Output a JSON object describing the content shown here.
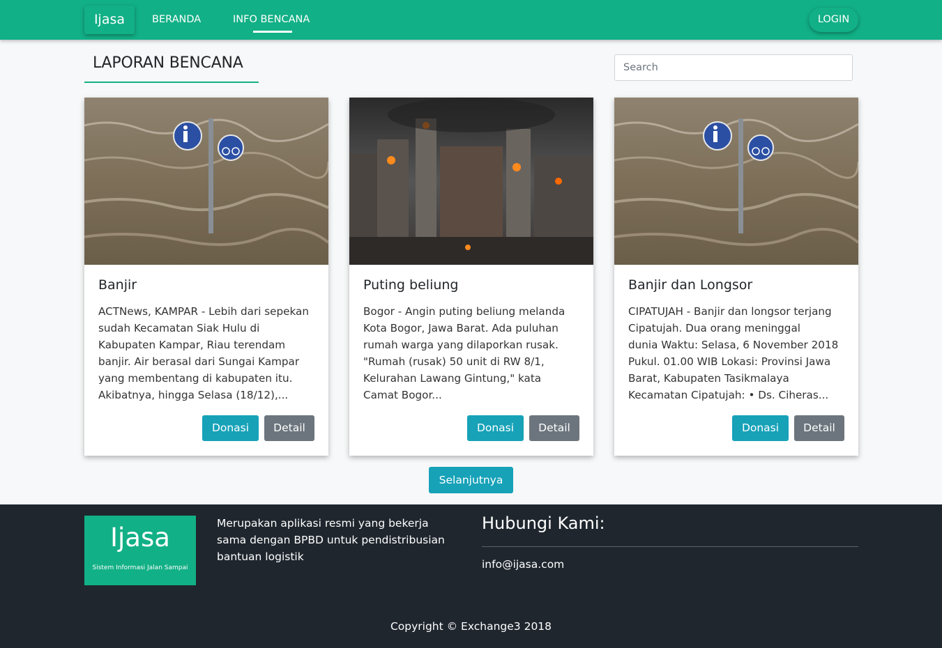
{
  "nav": {
    "brand": "Ijasa",
    "links": [
      "BERANDA",
      "INFO BENCANA"
    ],
    "login": "LOGIN"
  },
  "page": {
    "heading": "LAPORAN BENCANA",
    "search_placeholder": "Search",
    "next_label": "Selanjutnya"
  },
  "cards": [
    {
      "image": "flood-photo",
      "title": "Banjir",
      "text": "ACTNews, KAMPAR - Lebih dari sepekan\nsudah Kecamatan Siak Hulu di\nKabupaten Kampar, Riau terendam\nbanjir. Air berasal dari Sungai Kampar\nyang membentang di kabupaten itu.\nAkibatnya, hingga Selasa (18/12),...",
      "donate_label": "Donasi",
      "detail_label": "Detail"
    },
    {
      "image": "burning-city-photo",
      "title": "Puting beliung",
      "text": "Bogor - Angin puting beliung melanda\nKota Bogor, Jawa Barat. Ada puluhan\nrumah warga yang dilaporkan rusak.\n\"Rumah (rusak) 50 unit di RW 8/1,\nKelurahan Lawang Gintung,\" kata\nCamat Bogor...",
      "donate_label": "Donasi",
      "detail_label": "Detail"
    },
    {
      "image": "flood-photo",
      "title": "Banjir dan Longsor",
      "text": "CIPATUJAH - Banjir dan longsor terjang\nCipatujah. Dua orang meninggal\ndunia Waktu: Selasa, 6 November 2018\nPukul. 01.00 WIB Lokasi: Provinsi Jawa\nBarat, Kabupaten Tasikmalaya\nKecamatan Cipatujah: • Ds. Ciheras...",
      "donate_label": "Donasi",
      "detail_label": "Detail"
    }
  ],
  "footer": {
    "logo_text": "Ijasa",
    "logo_tagline": "Sistem Informasi Jalan Sampai",
    "description": "Merupakan aplikasi resmi yang bekerja sama dengan BPBD untuk pendistribusian bantuan logistik",
    "contact_title": "Hubungi Kami:",
    "email": "info@ijasa.com",
    "copyright": "Copyright © Exchange3 2018"
  },
  "colors": {
    "primary": "#12b086",
    "info": "#17a2b8",
    "secondary": "#6c757d",
    "footer_bg": "#1f262e"
  }
}
